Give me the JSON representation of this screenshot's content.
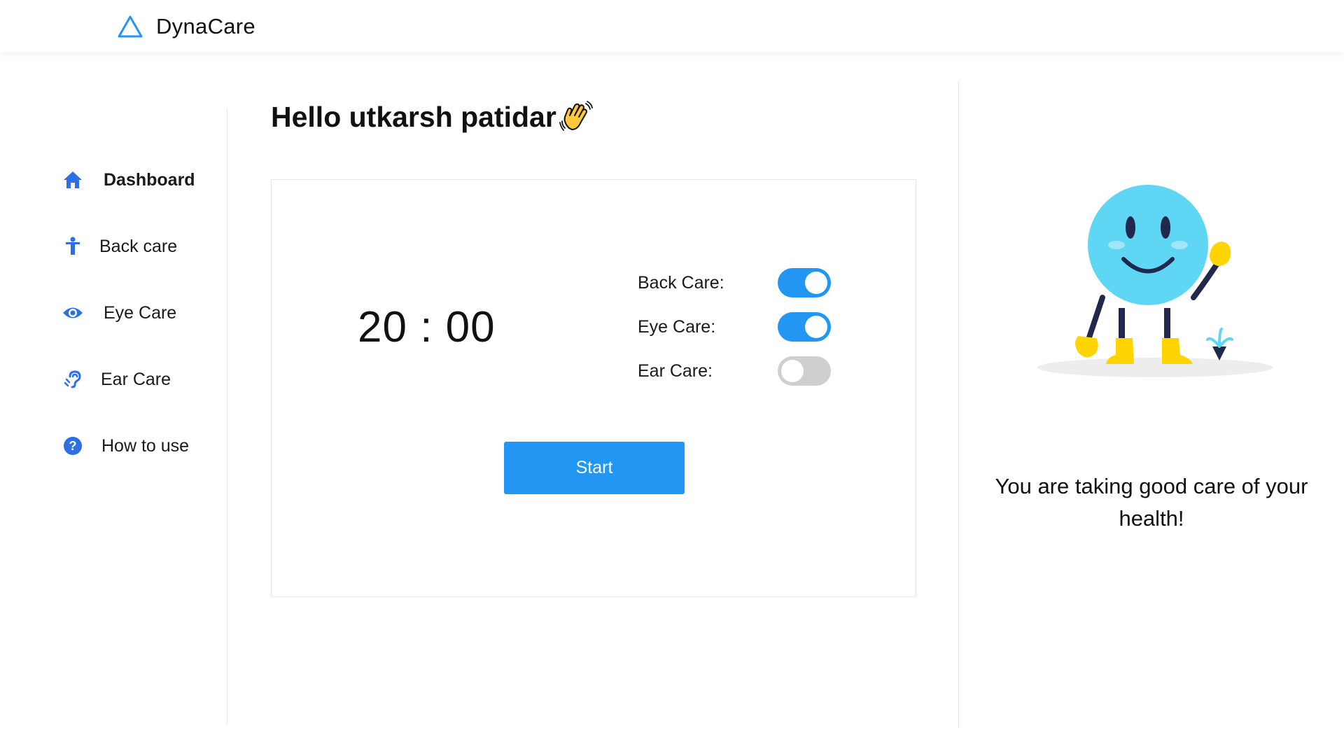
{
  "app": {
    "name": "DynaCare",
    "logo_icon": "triangle-logo-icon",
    "accent_color": "#2196F3"
  },
  "sidebar": {
    "items": [
      {
        "label": "Dashboard",
        "icon": "home-icon",
        "active": true
      },
      {
        "label": "Back care",
        "icon": "person-icon",
        "active": false
      },
      {
        "label": "Eye Care",
        "icon": "eye-icon",
        "active": false
      },
      {
        "label": "Ear Care",
        "icon": "ear-icon",
        "active": false
      },
      {
        "label": "How to use",
        "icon": "help-icon",
        "active": false
      }
    ]
  },
  "main": {
    "greeting": "Hello utkarsh patidar",
    "greeting_icon": "waving-hand-icon",
    "timer": "20 : 00",
    "toggles": [
      {
        "label": "Back Care:",
        "on": true
      },
      {
        "label": "Eye Care:",
        "on": true
      },
      {
        "label": "Ear Care:",
        "on": false
      }
    ],
    "start_label": "Start"
  },
  "right_panel": {
    "illustration": "smiley-character-illustration",
    "message": "You are taking good care of your health!"
  }
}
